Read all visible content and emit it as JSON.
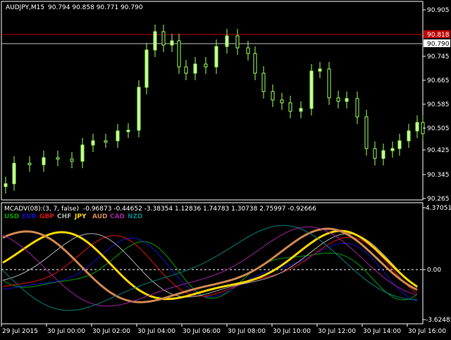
{
  "chart_header": {
    "symbol_label": "AUDJPY,M15",
    "ohlc_label": "90.794 90.858 90.771 90.790"
  },
  "price_axis": {
    "ticks": [
      "90.905",
      "90.825",
      "90.745",
      "90.665",
      "90.585",
      "90.505",
      "90.425",
      "90.345",
      "90.265"
    ],
    "ask_tag": "90.818",
    "bid_tag": "90.790"
  },
  "indicator": {
    "title": "MCADV(08):(3, 7, false)",
    "values_label": "-0.96873 -0.44652 -3.38354 1.12836 1.74783 1.30738 2.75997 -0.92666",
    "scale_max": "4.37051",
    "scale_zero": "0.00",
    "scale_min": "-3.62485",
    "legend": [
      {
        "name": "USD",
        "color": "#00a000"
      },
      {
        "name": "EUR",
        "color": "#1010c8"
      },
      {
        "name": "GBP",
        "color": "#e01010"
      },
      {
        "name": "CHF",
        "color": "#b0b0b0"
      },
      {
        "name": "JPY",
        "color": "#ffd700"
      },
      {
        "name": "AUD",
        "color": "#d08850"
      },
      {
        "name": "CAD",
        "color": "#a020a0"
      },
      {
        "name": "NZD",
        "color": "#008080"
      }
    ]
  },
  "time_axis": [
    "29 Jul 2015",
    "30 Jul 00:00",
    "30 Jul 02:00",
    "30 Jul 04:00",
    "30 Jul 06:00",
    "30 Jul 08:00",
    "30 Jul 10:00",
    "30 Jul 12:00",
    "30 Jul 14:00",
    "30 Jul 16:00"
  ],
  "colors": {
    "background": "#000000",
    "frame": "#ffffff",
    "bull_candle": "#000000",
    "bear_candle": "#c8ff9a",
    "wick": "#9cff5c",
    "ask_line": "#c00000",
    "bid_line": "#c0c0c0"
  }
}
